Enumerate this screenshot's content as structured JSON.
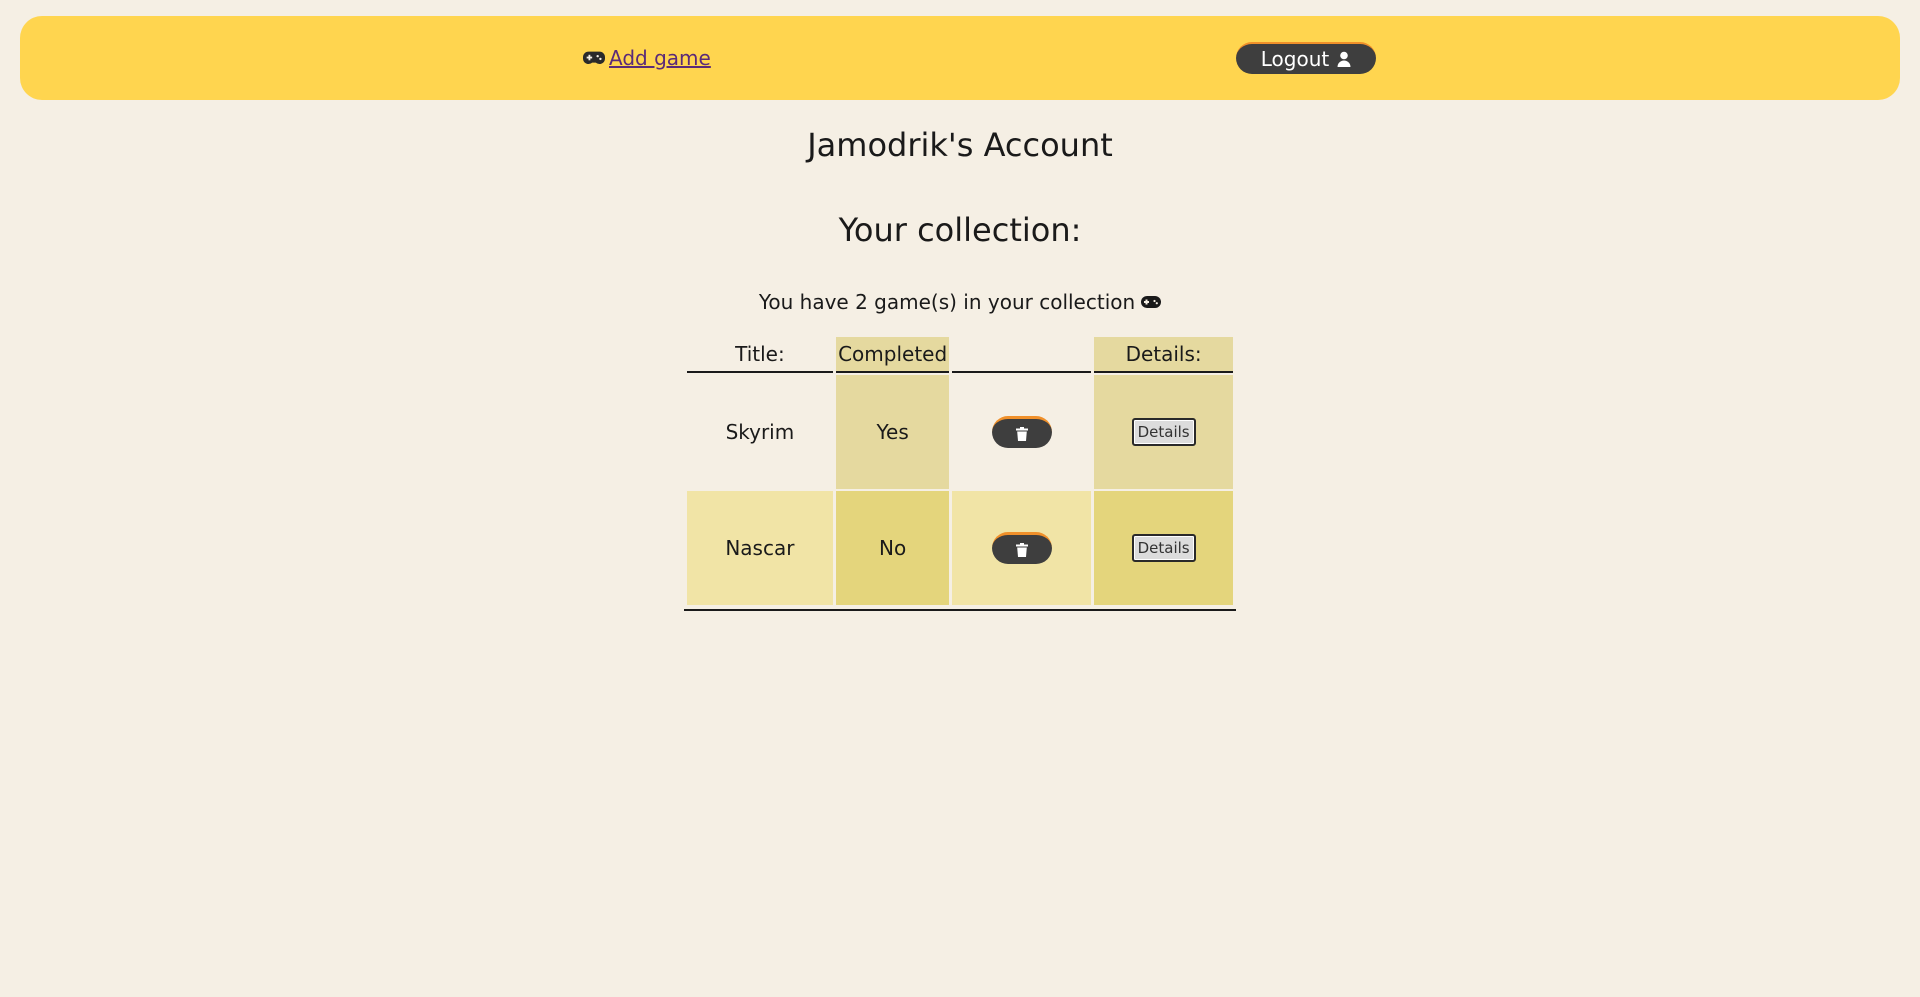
{
  "nav": {
    "add_game_label": "Add game",
    "logout_label": "Logout"
  },
  "account": {
    "heading": "Jamodrik's Account"
  },
  "collection": {
    "heading": "Your collection:",
    "count_text": "You have 2 game(s) in your collection"
  },
  "table": {
    "headers": {
      "title": "Title:",
      "completed": "Completed",
      "delete": "",
      "details": "Details:"
    },
    "rows": [
      {
        "title": "Skyrim",
        "completed": "Yes",
        "details_label": "Details"
      },
      {
        "title": "Nascar",
        "completed": "No",
        "details_label": "Details"
      }
    ]
  },
  "colors": {
    "navbar": "#ffd54f",
    "background": "#f5efe4",
    "button_dark": "#3e3e3e",
    "button_accent": "#f0902a",
    "link": "#5b2a78"
  },
  "icons": {
    "add_game": "gamepad-icon",
    "logout": "user-icon",
    "count": "gamepad-icon",
    "delete": "trash-icon"
  }
}
